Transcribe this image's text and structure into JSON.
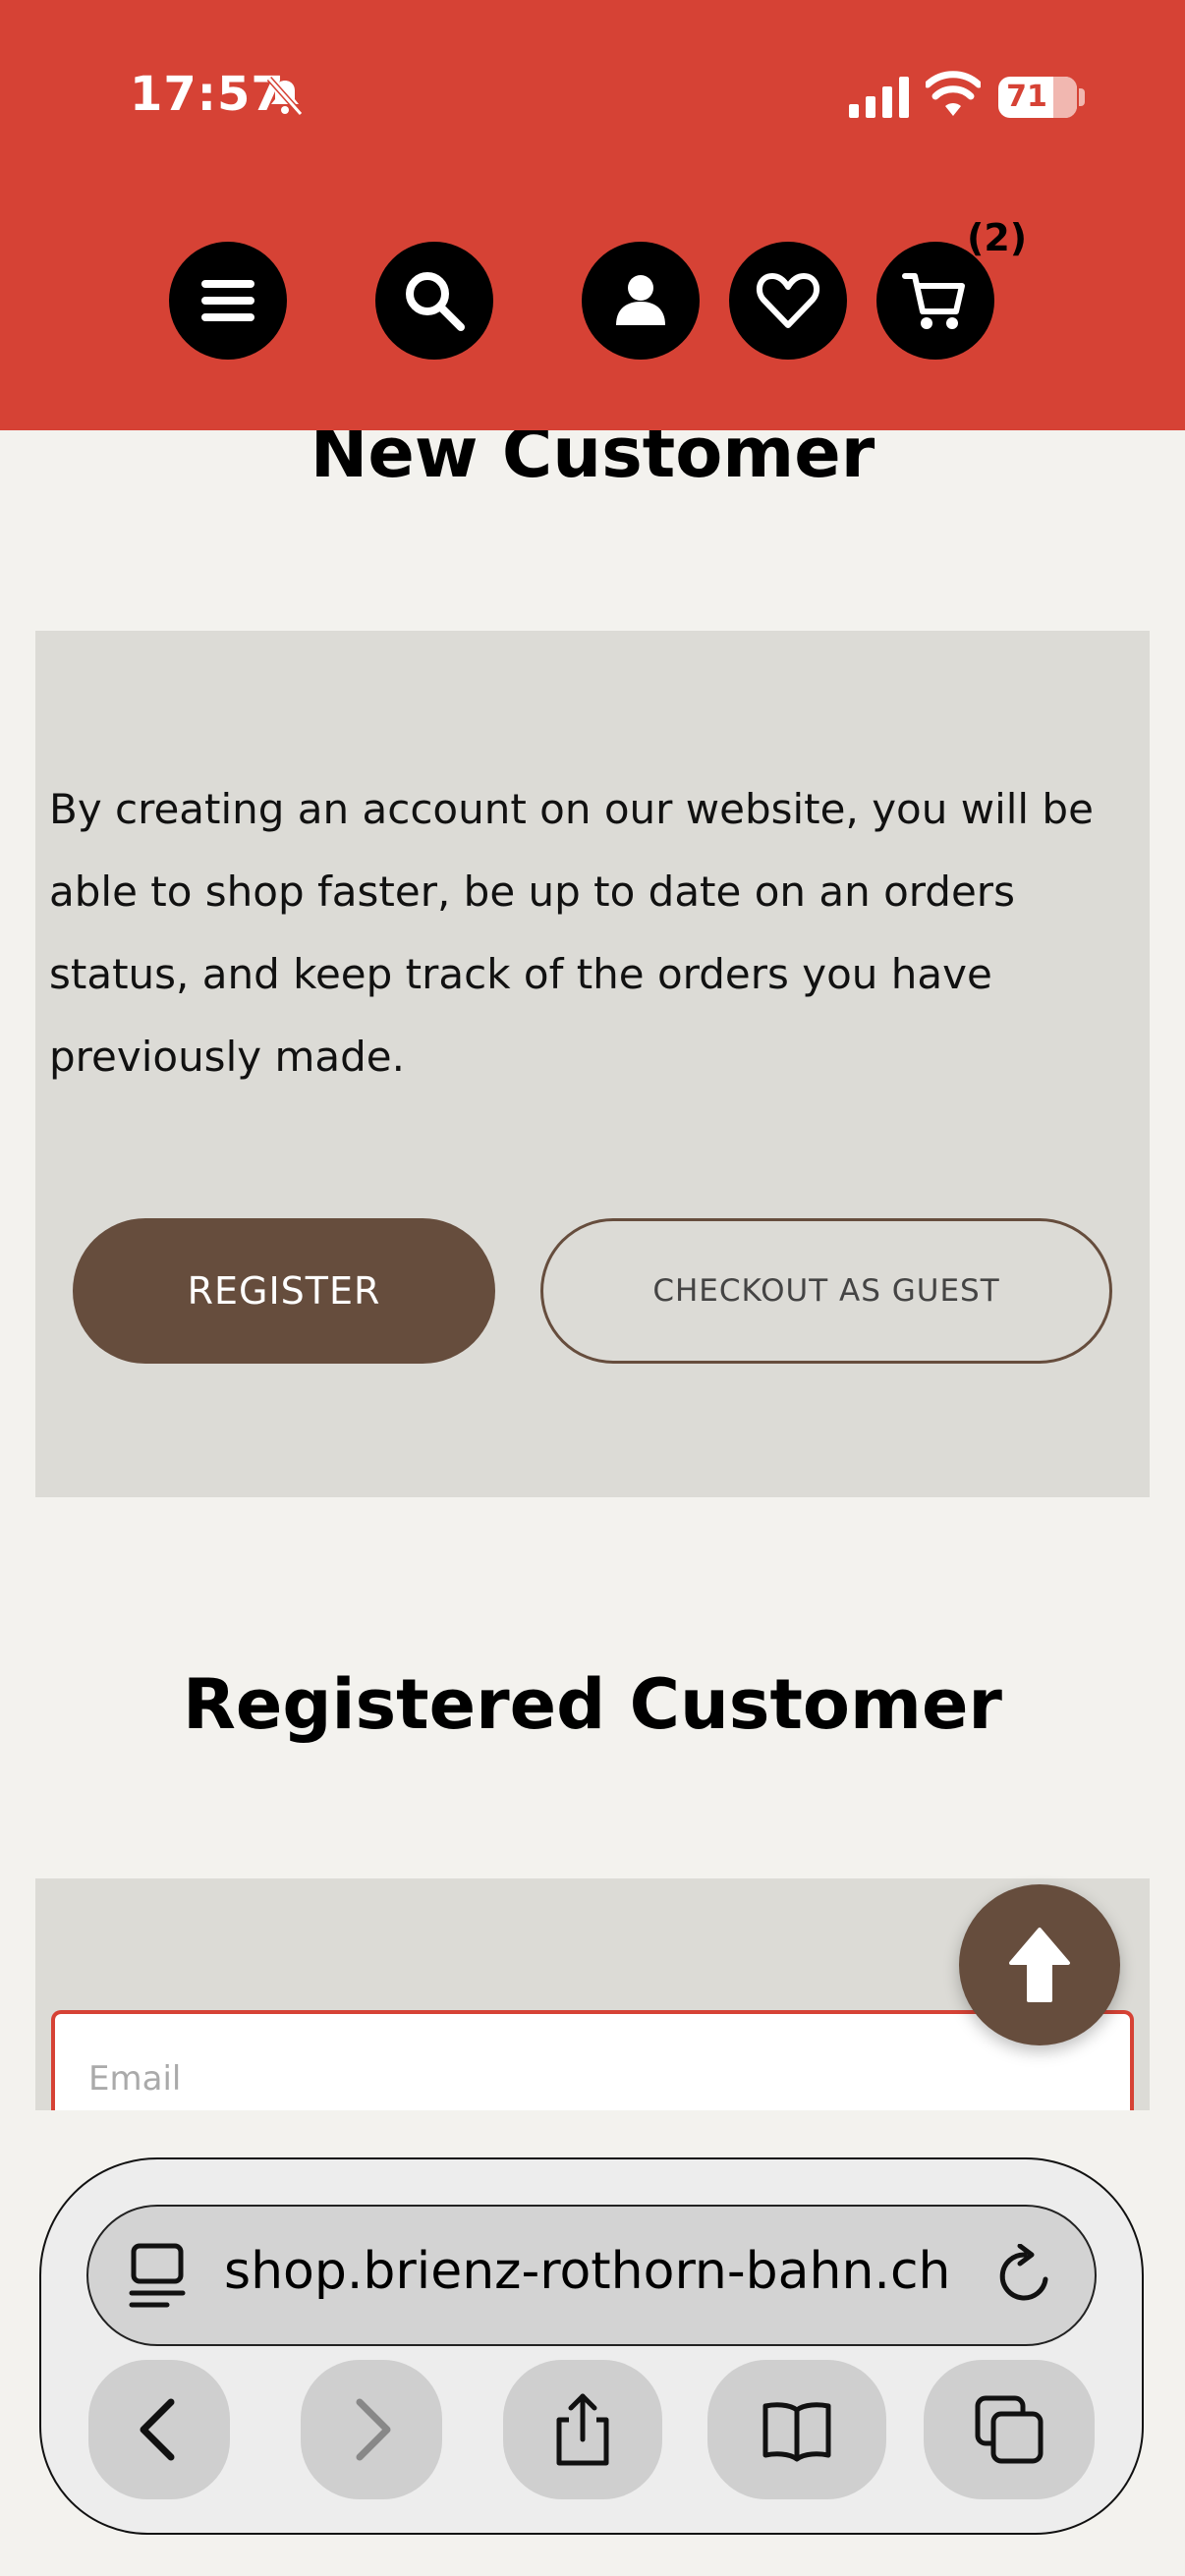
{
  "status_bar": {
    "time": "17:57",
    "battery": "71",
    "icons": [
      "bell-slash-icon",
      "cellular-signal-icon",
      "wifi-icon",
      "battery-icon"
    ]
  },
  "header": {
    "nav_icons": [
      "menu-icon",
      "search-icon",
      "account-icon",
      "wishlist-heart-icon",
      "cart-icon"
    ],
    "cart_count": "(2)",
    "accent_color": "#d64235"
  },
  "new_customer": {
    "title": "New Customer",
    "description": "By creating an account on our website, you will be able to shop faster, be up to date on an orders status, and keep track of the orders you have previously made.",
    "register_label": "REGISTER",
    "guest_label": "CHECKOUT AS GUEST",
    "button_color": "#664d3d"
  },
  "registered_customer": {
    "title": "Registered Customer",
    "email_placeholder": "Email"
  },
  "scroll_top": {
    "icon": "arrow-up-icon"
  },
  "browser": {
    "url": "shop.brienz-rothorn-bahn.ch",
    "icons": [
      "page-menu-icon",
      "reload-icon",
      "back-icon",
      "forward-icon",
      "share-icon",
      "bookmarks-icon",
      "tabs-icon"
    ]
  }
}
